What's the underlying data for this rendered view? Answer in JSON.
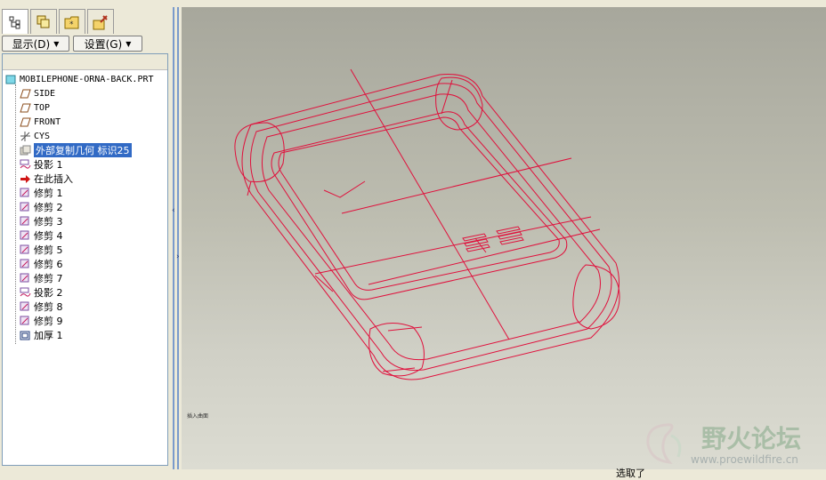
{
  "colors": {
    "wire": "#e0103c",
    "selection": "#316ac5"
  },
  "tabs": [
    {
      "icon": "model-tree-icon"
    },
    {
      "icon": "layers-icon"
    },
    {
      "icon": "folder-star-icon"
    },
    {
      "icon": "favorites-tools-icon"
    }
  ],
  "toolbar": {
    "display_label": "显示(D)",
    "settings_label": "设置(G)"
  },
  "tree": {
    "root": "MOBILEPHONE-ORNA-BACK.PRT",
    "items": [
      {
        "label": "SIDE",
        "icon": "datum-plane-icon"
      },
      {
        "label": "TOP",
        "icon": "datum-plane-icon"
      },
      {
        "label": "FRONT",
        "icon": "datum-plane-icon"
      },
      {
        "label": "CYS",
        "icon": "coordinate-system-icon"
      },
      {
        "label": "外部复制几何 标识25",
        "icon": "copy-geometry-icon",
        "selected": true
      },
      {
        "label": "投影 1",
        "icon": "projection-icon"
      },
      {
        "label": "在此插入",
        "icon": "insert-here-arrow-icon"
      },
      {
        "label": "修剪 1",
        "icon": "trim-icon"
      },
      {
        "label": "修剪 2",
        "icon": "trim-icon"
      },
      {
        "label": "修剪 3",
        "icon": "trim-icon"
      },
      {
        "label": "修剪 4",
        "icon": "trim-icon"
      },
      {
        "label": "修剪 5",
        "icon": "trim-icon"
      },
      {
        "label": "修剪 6",
        "icon": "trim-icon"
      },
      {
        "label": "修剪 7",
        "icon": "trim-icon"
      },
      {
        "label": "投影 2",
        "icon": "projection-icon"
      },
      {
        "label": "修剪 8",
        "icon": "trim-icon"
      },
      {
        "label": "修剪 9",
        "icon": "trim-icon"
      },
      {
        "label": "加厚 1",
        "icon": "thicken-icon"
      }
    ]
  },
  "graphics": {
    "small_label": "插入曲面"
  },
  "status": {
    "text": "选取了"
  },
  "watermark": {
    "title": "野火论坛",
    "url": "www.proewildfire.cn"
  }
}
